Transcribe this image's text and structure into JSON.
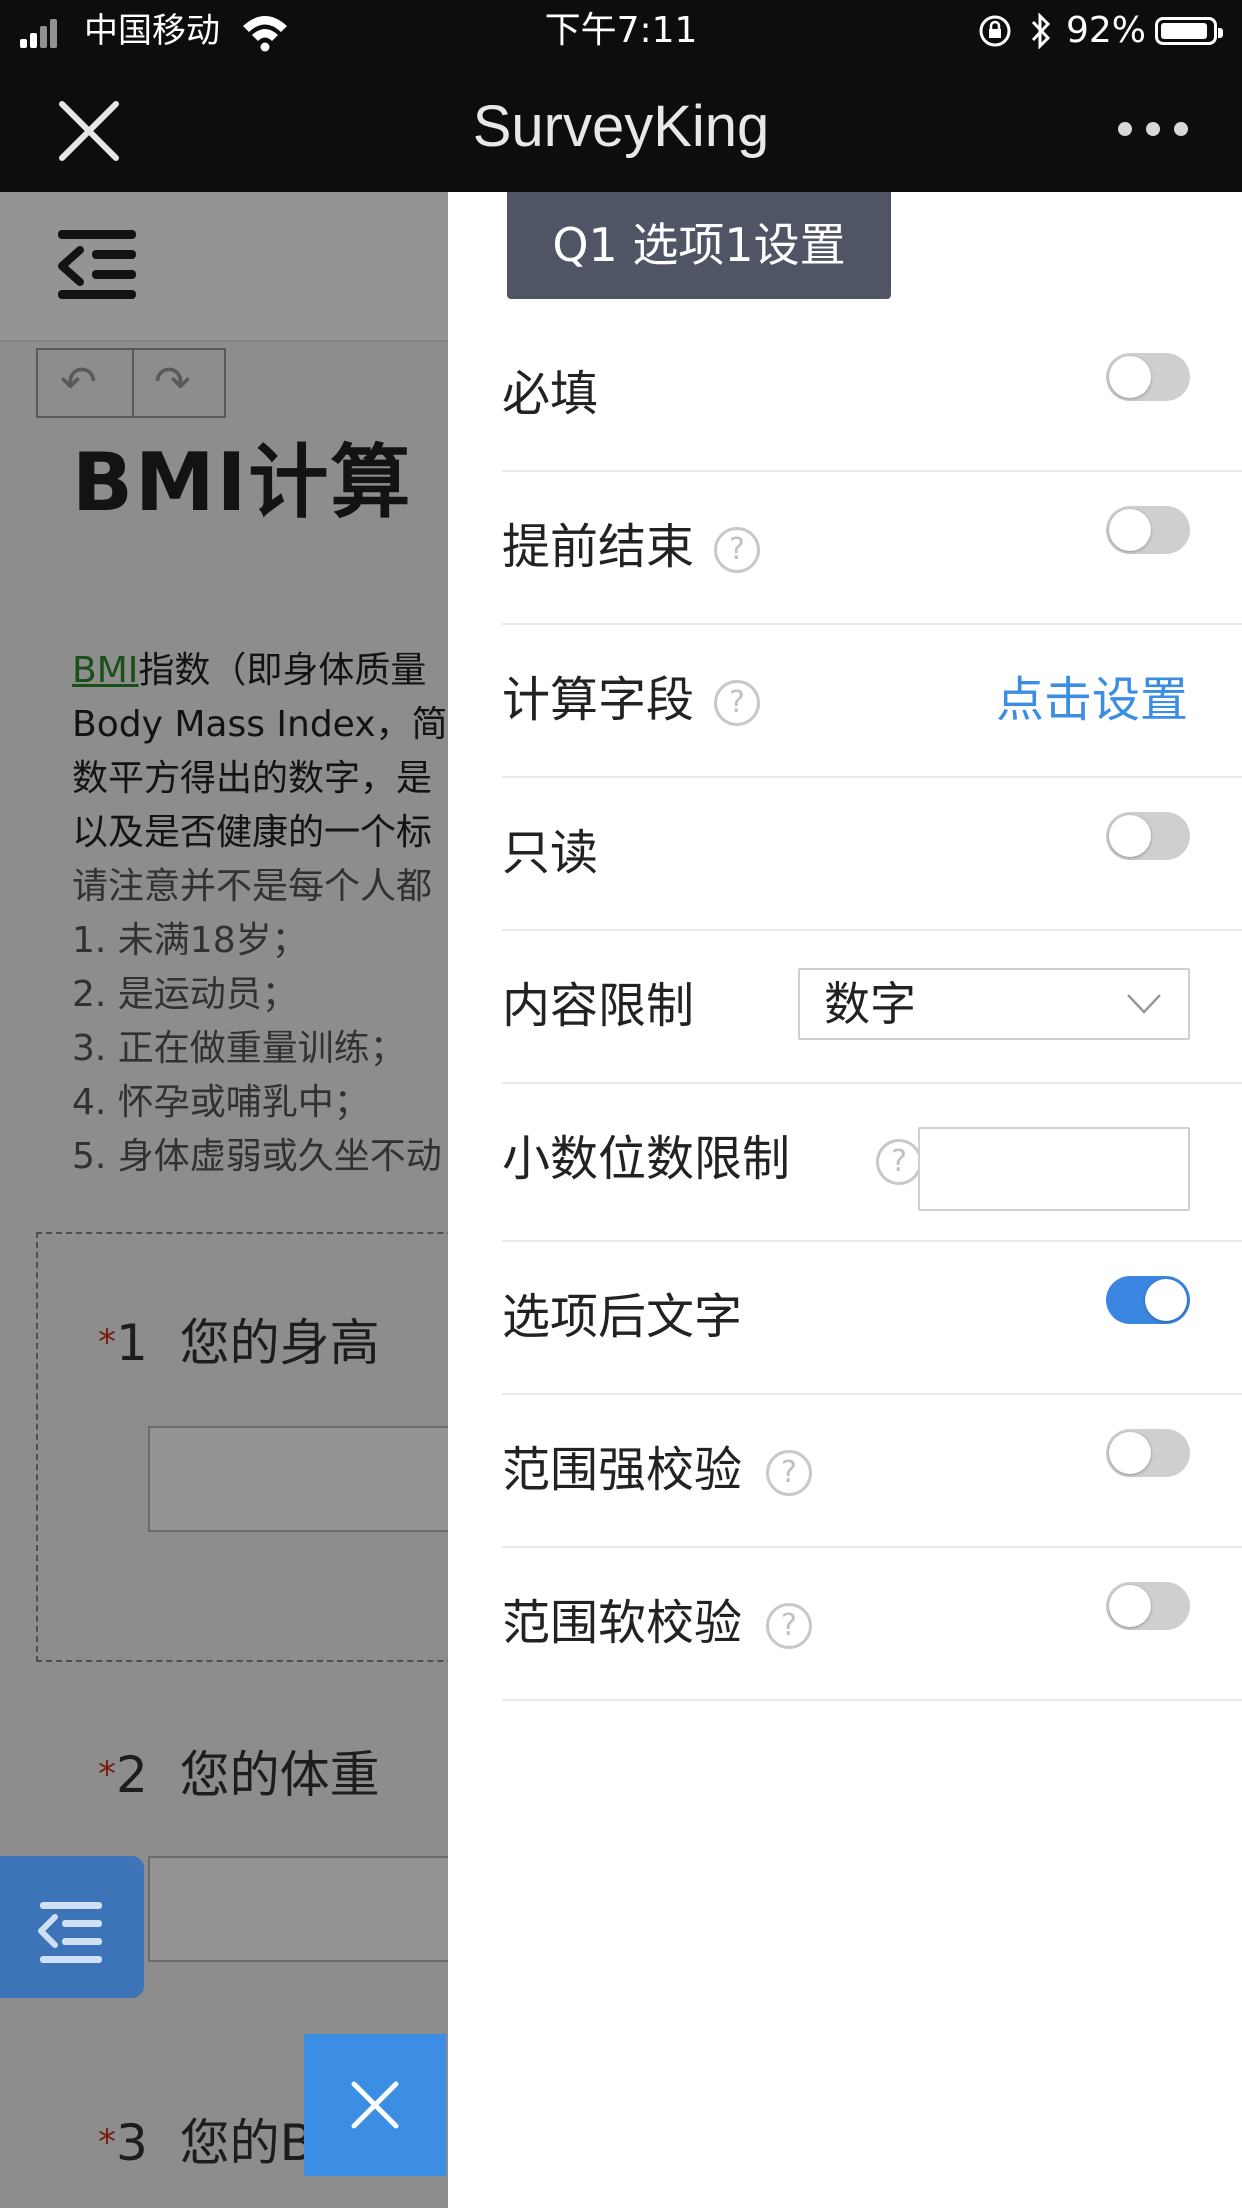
{
  "status_bar": {
    "carrier": "中国移动",
    "time": "下午7:11",
    "battery_percent": "92%",
    "battery_level": 0.92
  },
  "nav": {
    "title": "SurveyKing"
  },
  "background_page": {
    "heading": "BMI计算",
    "para_link": "BMI",
    "para_line1_rest": "指数（即身体质量",
    "para_line2": "Body Mass Index，简",
    "para_line3": "数平方得出的数字，是",
    "para_line4": "以及是否健康的一个标",
    "para_line5": "请注意并不是每个人都",
    "list": [
      "1. 未满18岁；",
      "2. 是运动员；",
      "3. 正在做重量训练；",
      "4. 怀孕或哺乳中；",
      "5. 身体虚弱或久坐不动"
    ],
    "questions": [
      {
        "star": "*",
        "num": "1",
        "text": "您的身高"
      },
      {
        "star": "*",
        "num": "2",
        "text": "您的体重"
      },
      {
        "star": "*",
        "num": "3",
        "text": "您的BMI"
      }
    ]
  },
  "drawer": {
    "title": "Q1 选项1设置",
    "help_glyph": "?",
    "rows": [
      {
        "label": "必填",
        "control": "toggle",
        "on": false
      },
      {
        "label": "提前结束",
        "control": "toggle",
        "on": false,
        "help": true
      },
      {
        "label": "计算字段",
        "control": "link",
        "link_text": "点击设置",
        "help": true
      },
      {
        "label": "只读",
        "control": "toggle",
        "on": false
      },
      {
        "label": "内容限制",
        "control": "select",
        "value": "数字"
      },
      {
        "label": "小数位数限制",
        "control": "input",
        "value": "",
        "help": true
      },
      {
        "label": "选项后文字",
        "control": "toggle",
        "on": true
      },
      {
        "label": "范围强校验",
        "control": "toggle",
        "on": false,
        "help": true
      },
      {
        "label": "范围软校验",
        "control": "toggle",
        "on": false,
        "help": true
      }
    ]
  },
  "colors": {
    "accent": "#3b8ee4",
    "toggle_on": "#3b86e0",
    "drawer_title_bg": "#4f5564",
    "required_star": "#d93025"
  }
}
